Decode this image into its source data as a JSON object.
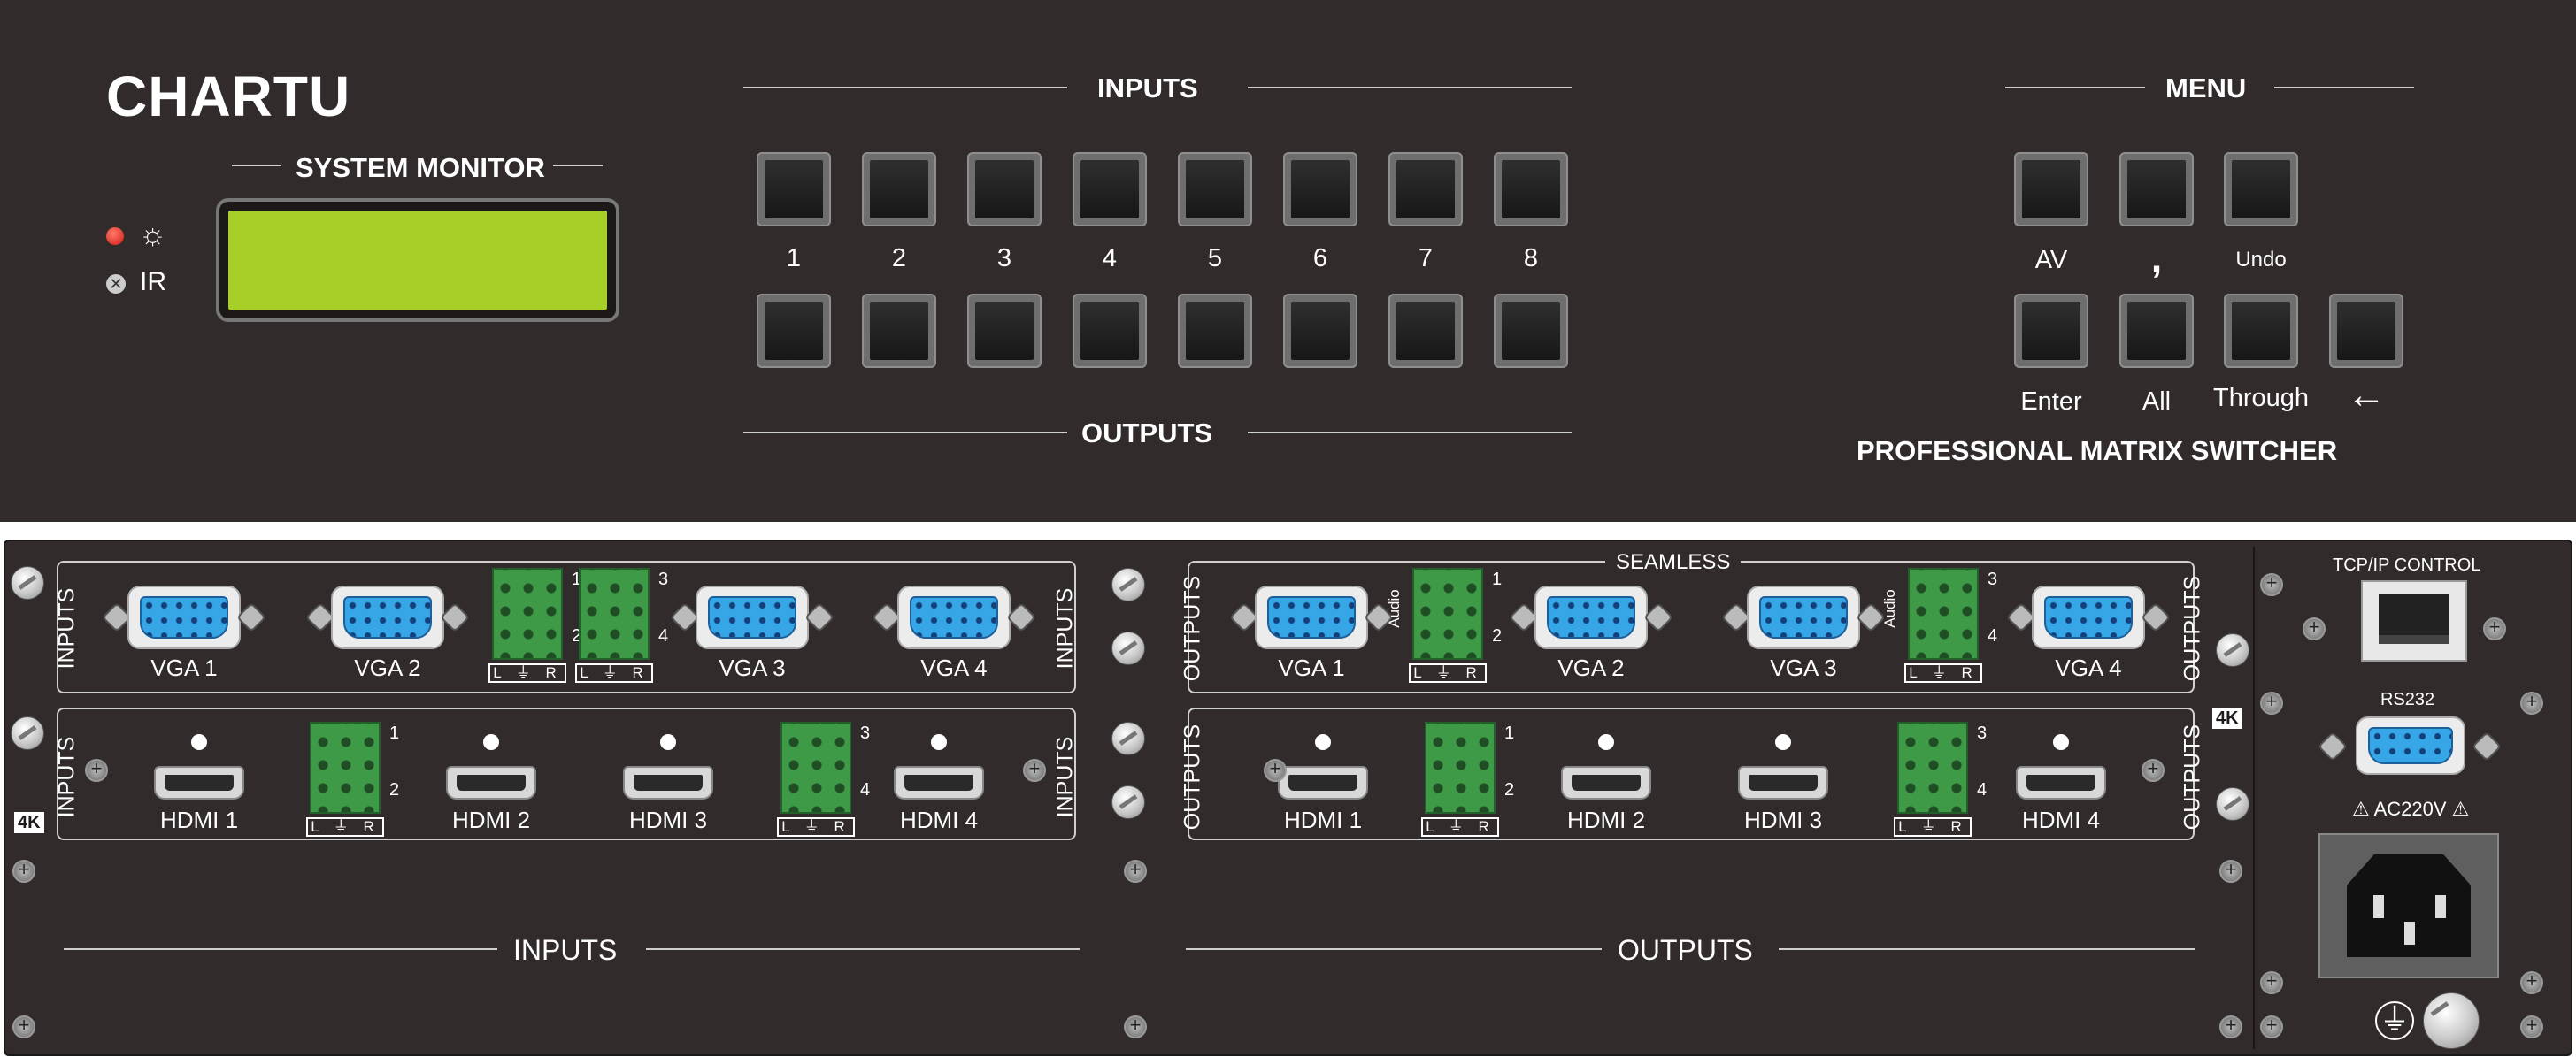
{
  "front": {
    "brand": "CHARTU",
    "system_monitor": "SYSTEM MONITOR",
    "indicators": {
      "ir": "IR"
    },
    "inputs_title": "INPUTS",
    "outputs_title": "OUTPUTS",
    "channel_numbers": [
      "1",
      "2",
      "3",
      "4",
      "5",
      "6",
      "7",
      "8"
    ],
    "menu_title": "MENU",
    "menu_row1": [
      "AV",
      ",",
      "Undo"
    ],
    "menu_row2": [
      "Enter",
      "All",
      "Through"
    ],
    "backspace_symbol": "←",
    "subtitle": "PROFESSIONAL MATRIX SWITCHER",
    "lcd_color": "#a8cf28",
    "power_led_color": "#e0201c"
  },
  "rear": {
    "seamless": "SEAMLESS",
    "vga_in": [
      "VGA 1",
      "VGA 2",
      "VGA 3",
      "VGA 4"
    ],
    "vga_out": [
      "VGA 1",
      "VGA 2",
      "VGA 3",
      "VGA 4"
    ],
    "hdmi_in": [
      "HDMI 1",
      "HDMI 2",
      "HDMI 3",
      "HDMI 4"
    ],
    "hdmi_out": [
      "HDMI 1",
      "HDMI 2",
      "HDMI 3",
      "HDMI 4"
    ],
    "inputs": "INPUTS",
    "outputs": "OUTPUTS",
    "k4": "4K",
    "audio": "Audio",
    "lr": "L ⏚ R",
    "terminal_numbers": [
      "1",
      "2",
      "3",
      "4"
    ],
    "tcp": "TCP/IP CONTROL",
    "rs232": "RS232",
    "ac": "⚠ AC220V ⚠",
    "ground": "⏚",
    "blank_inputs": "INPUTS",
    "blank_outputs": "OUTPUTS"
  }
}
